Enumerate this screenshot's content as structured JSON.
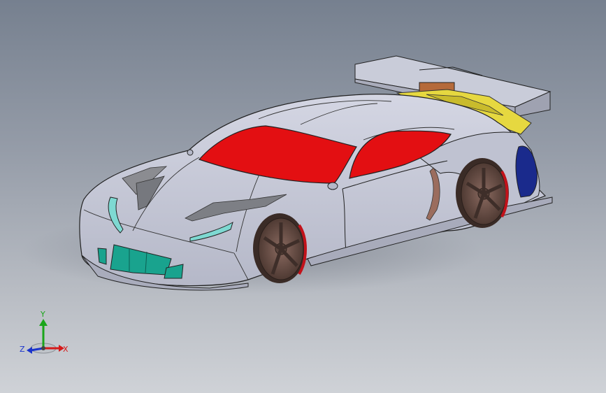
{
  "viewport": {
    "background_top": "#76808f",
    "background_bottom": "#cfd2d7"
  },
  "model": {
    "body_color": "#c7cad9",
    "windshield_color": "#e30f12",
    "headlight_color": "#7ed9d2",
    "grille_color": "#19a38e",
    "side_window_color": "#1a2a8c",
    "spoiler_support_color": "#e6d840",
    "wheel_color": "#6b4d44",
    "brake_color": "#c2121a"
  },
  "triad": {
    "y_label": "Y",
    "x_label": "X",
    "z_label": "Z",
    "y_color": "#1aa51a",
    "x_color": "#d61a1a",
    "z_color": "#1a33cc"
  }
}
